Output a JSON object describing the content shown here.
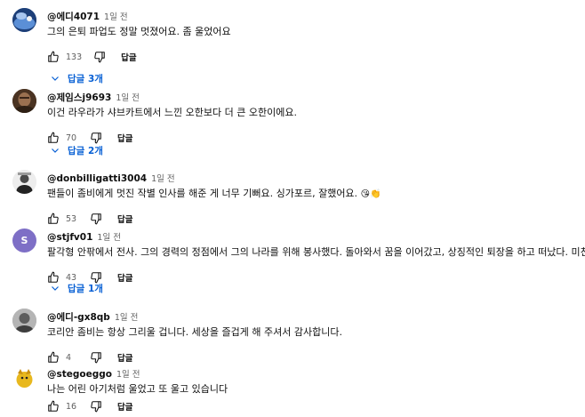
{
  "comments": [
    {
      "author": "@에디4071",
      "time": "1일 전",
      "text": "그의 은퇴 파업도 정말 멋졌어요. 좀 울었어요",
      "likes": "133",
      "reply_label": "답글",
      "replies_label": "답글 3개",
      "avatar": {
        "kind": "photo-blue",
        "color": "#3d6fb0"
      }
    },
    {
      "author": "@제임스j9693",
      "time": "1일 전",
      "text": "이건 라우라가 샤브카트에서 느낀 오한보다 더 큰 오한이에요.",
      "likes": "70",
      "reply_label": "답글",
      "replies_label": "답글 2개",
      "avatar": {
        "kind": "photo-portrait",
        "color": "#6b4a32"
      }
    },
    {
      "author": "@donbilligatti3004",
      "time": "1일 전",
      "text": "팬들이 좀비에게 멋진 작별 인사를 해준 게 너무 기뻐요. 싱가포르, 잘했어요.",
      "emojis": "😘👏",
      "likes": "53",
      "reply_label": "답글",
      "avatar": {
        "kind": "photo-bw",
        "color": "#cfcfcf"
      }
    },
    {
      "author": "@stjfv01",
      "time": "1일 전",
      "text": "팔각형 안팎에서 전사. 그의 경력의 정점에서 그의 나라를 위해 봉사했다. 돌아와서 꿈을 이어갔고, 상징적인 퇴장을 하고 떠났다. 미친 삶",
      "heart": "♥",
      "likes": "43",
      "reply_label": "답글",
      "replies_label": "답글 1개",
      "avatar": {
        "kind": "letter",
        "letter": "S",
        "color": "#7e6fc6"
      }
    },
    {
      "author": "@에디-gx8qb",
      "time": "1일 전",
      "text": "코리안 좀비는 항상 그리울 겁니다. 세상을 즐겁게 해 주셔서 감사합니다.",
      "likes": "4",
      "reply_label": "답글",
      "avatar": {
        "kind": "photo-grey",
        "color": "#9a9a9a"
      }
    },
    {
      "author": "@stegoeggo",
      "time": "1일 전",
      "text": "나는 어린 아기처럼 울었고 또 울고 있습니다",
      "likes": "16",
      "reply_label": "답글",
      "avatar": {
        "kind": "photo-yellow",
        "color": "#e8b81e"
      }
    }
  ],
  "icons": {
    "like": "thumbs-up-icon",
    "dislike": "thumbs-down-icon",
    "expand": "chevron-down-icon"
  },
  "colors": {
    "link": "#065fd4",
    "secondary_text": "#606060",
    "heart": "#e0245e"
  }
}
